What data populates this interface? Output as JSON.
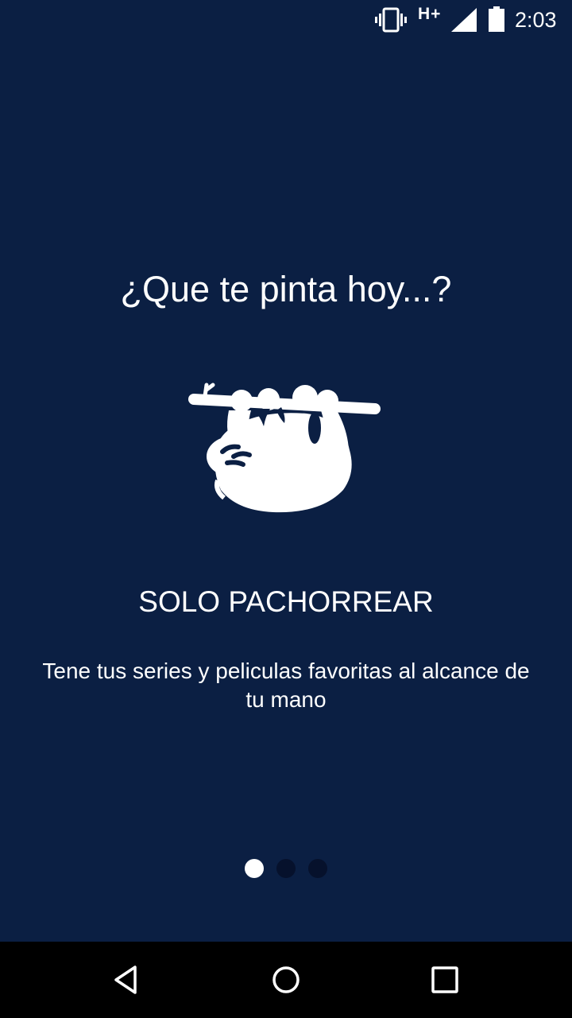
{
  "status_bar": {
    "network": "H+",
    "time": "2:03",
    "icons": [
      "vibrate-icon",
      "signal-icon",
      "battery-icon"
    ]
  },
  "onboarding": {
    "headline": "¿Que te pinta hoy...?",
    "illustration": "sloth-icon",
    "title": "SOLO PACHORREAR",
    "description": "Tene tus series y peliculas favoritas al alcance de tu mano",
    "page_count": 3,
    "active_page": 1
  },
  "nav_bar": {
    "icons": [
      "back-icon",
      "home-icon",
      "recents-icon"
    ]
  },
  "colors": {
    "background": "#0b1f43",
    "text": "#ffffff",
    "dot_active": "#ffffff",
    "dot_inactive": "#06112c",
    "nav_background": "#000000"
  }
}
